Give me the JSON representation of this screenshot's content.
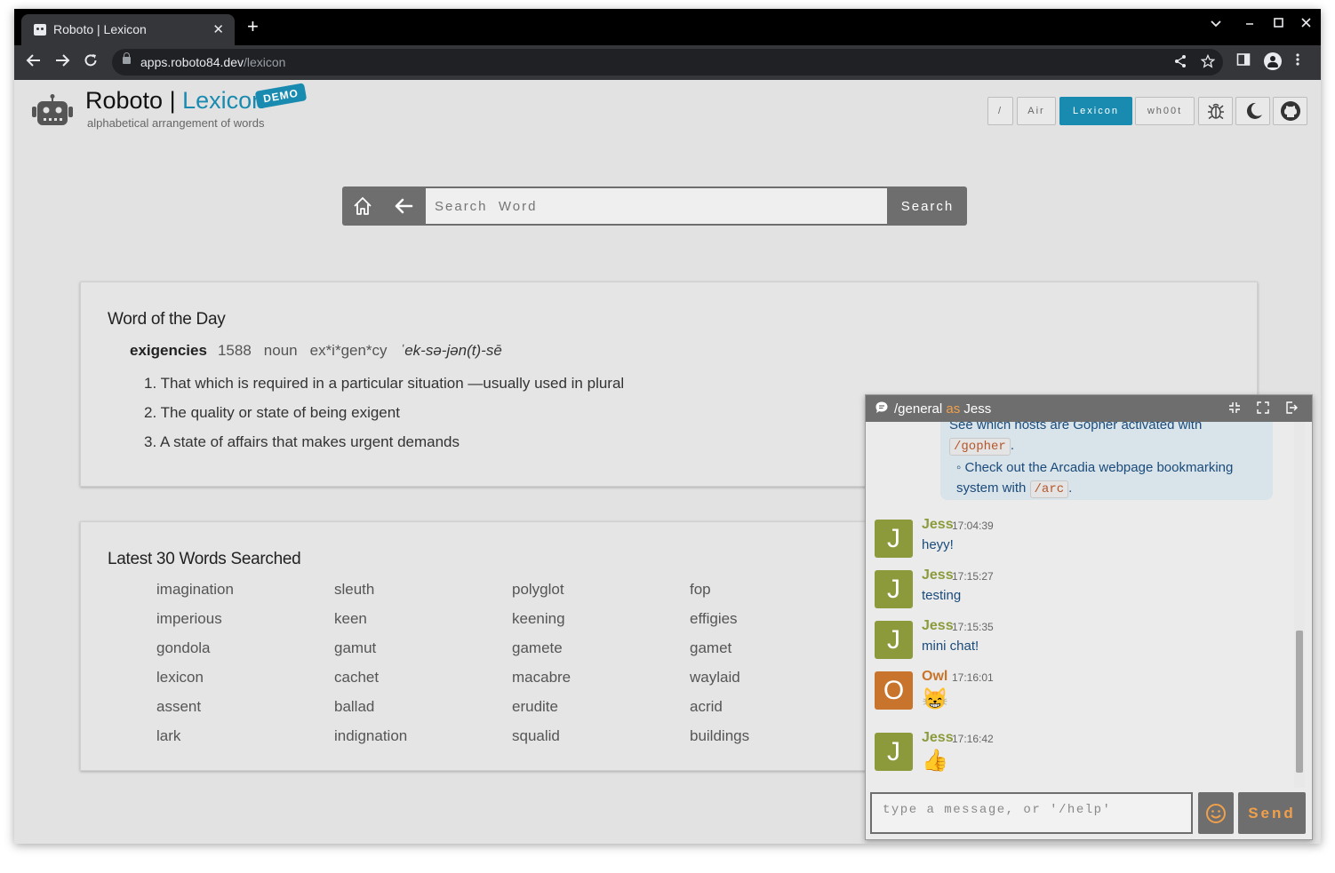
{
  "browser": {
    "tab_title": "Roboto | Lexicon",
    "tab_close": "✕",
    "new_tab": "+",
    "url_host": "apps.roboto84.dev",
    "url_path": "/lexicon"
  },
  "header": {
    "brand_main": "Roboto | ",
    "brand_app": "Lexicon",
    "demo_badge": "DEMO",
    "tagline": "alphabetical arrangement of words"
  },
  "nav": {
    "root": "/",
    "air": "Air",
    "lexicon": "Lexicon",
    "whoot": "wh00t",
    "active": "Lexicon"
  },
  "search": {
    "placeholder": "Search  Word",
    "button": "Search"
  },
  "word_of_day": {
    "heading": "Word of the Day",
    "word": "exigencies",
    "year": "1588",
    "pos": "noun",
    "syllables": "ex*i*gen*cy",
    "pronunciation": "ˈek-sə-jən(t)-sē",
    "definitions": [
      "1. That which is required in a particular situation —usually used in plural",
      "2. The quality or state of being exigent",
      "3. A state of affairs that makes urgent demands"
    ]
  },
  "latest": {
    "heading": "Latest 30 Words Searched",
    "columns": [
      [
        "imagination",
        "imperious",
        "gondola",
        "lexicon",
        "assent",
        "lark"
      ],
      [
        "sleuth",
        "keen",
        "gamut",
        "cachet",
        "ballad",
        "indignation"
      ],
      [
        "polyglot",
        "keening",
        "gamete",
        "macabre",
        "erudite",
        "squalid"
      ],
      [
        "fop",
        "effigies",
        "gamet",
        "waylaid",
        "acrid",
        "buildings"
      ]
    ]
  },
  "chat": {
    "channel": "/general",
    "as_word": "as",
    "user": "Jess",
    "system_msg": {
      "line1": "See which hosts are Gopher activated with",
      "code1": "/gopher",
      "line2": "◦ Check out the Arcadia webpage bookmarking system with",
      "code2": "/arc"
    },
    "messages": [
      {
        "initial": "J",
        "name": "Jess",
        "time": "17:04:39",
        "text": "heyy!"
      },
      {
        "initial": "J",
        "name": "Jess",
        "time": "17:15:27",
        "text": "testing"
      },
      {
        "initial": "J",
        "name": "Jess",
        "time": "17:15:35",
        "text": "mini chat!"
      },
      {
        "initial": "O",
        "name": "Owl",
        "time": "17:16:01",
        "text": "😸"
      },
      {
        "initial": "J",
        "name": "Jess",
        "time": "17:16:42",
        "text": "👍"
      }
    ],
    "input_placeholder": "type  a  message,  or  '/help'",
    "send": "Send"
  },
  "colors": {
    "accent": "#1a8bb0",
    "chat_accent": "#f0a04b",
    "jess_avatar": "#8c9a3c",
    "owl_avatar": "#c8742c"
  }
}
